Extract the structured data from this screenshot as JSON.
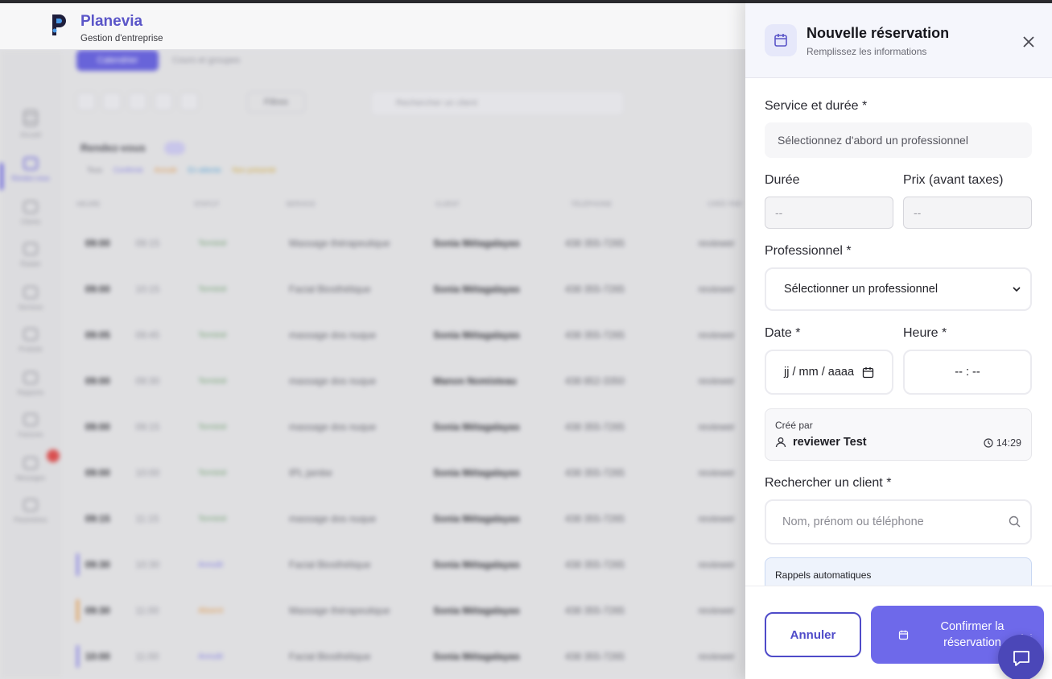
{
  "app": {
    "brand_name": "Planevia",
    "brand_sub": "Gestion d'entreprise"
  },
  "background": {
    "toolbar_btn": "Calendrier",
    "toolbar_link": "Cours et groupes",
    "filter": "Filtres",
    "search_placeholder": "Rechercher un client",
    "heading": "Rendez-vous",
    "legend": [
      "Tous",
      "Confirmé",
      "Annulé",
      "En attente",
      "Non présenté"
    ],
    "columns": [
      "HEURE",
      "STATUT",
      "SERVICE",
      "CLIENT",
      "TÉLÉPHONE",
      "CRÉÉ PAR"
    ],
    "sidebar": [
      "Accueil",
      "Rendez-vous",
      "Clients",
      "Équipe",
      "Services",
      "Produits",
      "Rapports",
      "Factures",
      "Messages",
      "Paramètres"
    ],
    "rows": [
      {
        "time": "09:00",
        "end": "09:15",
        "status": "Terminé",
        "service": "Massage thérapeutique",
        "client": "Sonia Métagalayas",
        "tel": "438 355-7265",
        "more": "reviewer"
      },
      {
        "time": "09:00",
        "end": "10:15",
        "status": "Terminé",
        "service": "Facial Biosthétique",
        "client": "Sonia Métagalayas",
        "tel": "438 355-7265",
        "more": "reviewer"
      },
      {
        "time": "09:05",
        "end": "09:45",
        "status": "Terminé",
        "service": "massage dos nuque",
        "client": "Sonia Métagalayas",
        "tel": "438 355-7265",
        "more": "reviewer"
      },
      {
        "time": "09:00",
        "end": "09:30",
        "status": "Terminé",
        "service": "massage dos nuque",
        "client": "Manon Nomisteau",
        "tel": "438 852-3350",
        "more": "reviewer"
      },
      {
        "time": "09:00",
        "end": "09:15",
        "status": "Terminé",
        "service": "massage dos nuque",
        "client": "Sonia Métagalayas",
        "tel": "438 355-7265",
        "more": "reviewer"
      },
      {
        "time": "09:00",
        "end": "10:00",
        "status": "Terminé",
        "service": "IPL jambe",
        "client": "Sonia Métagalayas",
        "tel": "438 355-7265",
        "more": "reviewer"
      },
      {
        "time": "09:15",
        "end": "11:15",
        "status": "Terminé",
        "service": "massage dos nuque",
        "client": "Sonia Métagalayas",
        "tel": "438 355-7265",
        "more": "reviewer"
      },
      {
        "time": "09:30",
        "end": "10:30",
        "status": "Annulé",
        "service": "Facial Biosthétique",
        "client": "Sonia Métagalayas",
        "tel": "438 355-7265",
        "more": "reviewer"
      },
      {
        "time": "09:30",
        "end": "11:00",
        "status": "Absent",
        "service": "Massage thérapeutique",
        "client": "Sonia Métagalayas",
        "tel": "438 355-7265",
        "more": "reviewer"
      },
      {
        "time": "10:00",
        "end": "11:00",
        "status": "Annulé",
        "service": "Facial Biosthétique",
        "client": "Sonia Métagalayas",
        "tel": "438 355-7265",
        "more": "reviewer"
      }
    ]
  },
  "drawer": {
    "title": "Nouvelle réservation",
    "subtitle": "Remplissez les informations",
    "service_label": "Service et durée *",
    "service_placeholder": "Sélectionnez d'abord un professionnel",
    "duration_label": "Durée",
    "duration_value": "--",
    "price_label": "Prix (avant taxes)",
    "price_value": "--",
    "pro_label": "Professionnel *",
    "pro_select": "Sélectionner un professionnel",
    "date_label": "Date *",
    "date_value": "jj / mm / aaaa",
    "time_label": "Heure *",
    "time_value": "-- : --",
    "created_label": "Créé par",
    "created_user": "reviewer Test",
    "created_time": "14:29",
    "client_label": "Rechercher un client *",
    "client_placeholder": "Nom, prénom ou téléphone",
    "reminders_label": "Rappels automatiques",
    "cancel": "Annuler",
    "confirm_line1": "Confirmer la",
    "confirm_line2": "réservation"
  },
  "colors": {
    "accent": "#6e69ea",
    "accent_dark": "#4f4bc9",
    "brand": "#5a55c8",
    "reminder_bg": "#eef3fc"
  },
  "icons": [
    "planevia-logo",
    "calendar-icon",
    "close-icon",
    "chevron-down-icon",
    "user-icon",
    "clock-icon",
    "search-icon",
    "chat-icon"
  ]
}
